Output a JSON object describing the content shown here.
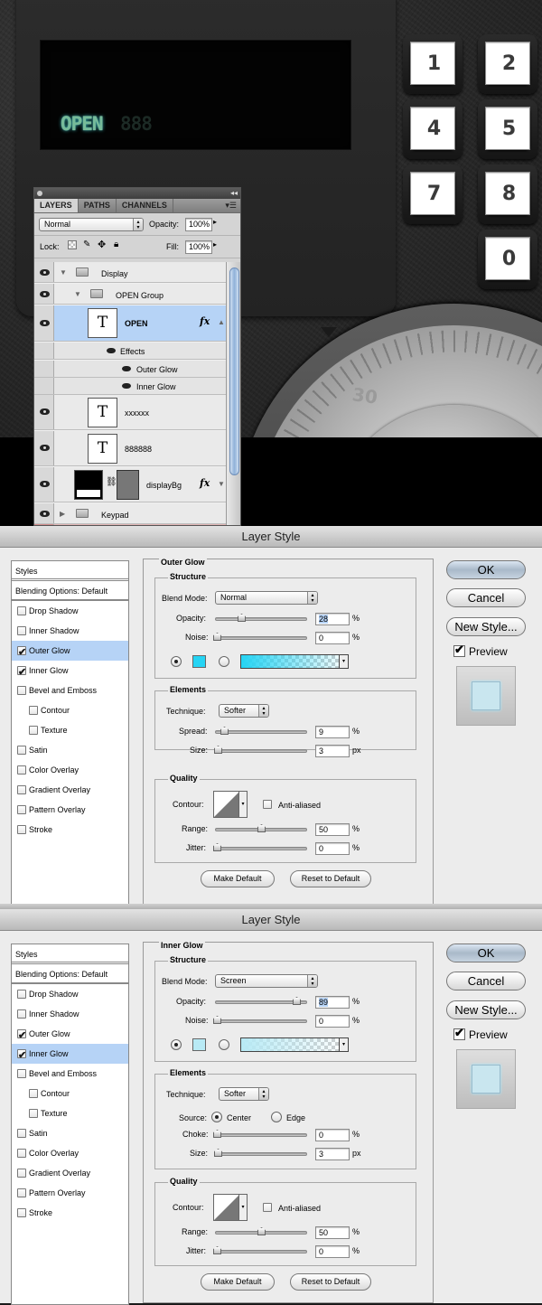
{
  "scene": {
    "display_text": "OPEN",
    "display_ghost": "888",
    "keys": [
      "1",
      "2",
      "4",
      "5",
      "7",
      "8",
      "0"
    ],
    "dial_number": "30"
  },
  "layers_panel": {
    "tabs": [
      "LAYERS",
      "PATHS",
      "CHANNELS"
    ],
    "blend_mode": "Normal",
    "opacity_label": "Opacity:",
    "opacity_value": "100%",
    "lock_label": "Lock:",
    "fill_label": "Fill:",
    "fill_value": "100%",
    "layers": {
      "display": "Display",
      "open_group": "OPEN Group",
      "open": "OPEN",
      "effects": "Effects",
      "outer_glow": "Outer Glow",
      "inner_glow": "Inner Glow",
      "xxxxxx": "xxxxxx",
      "eights": "888888",
      "displaybg": "displayBg",
      "keypad": "Keypad"
    },
    "fx_label": "fx",
    "thumb_letter": "T"
  },
  "dialog1": {
    "title": "Layer Style",
    "styles_header": "Styles",
    "blending": "Blending Options: Default",
    "items": [
      "Drop Shadow",
      "Inner Shadow",
      "Outer Glow",
      "Inner Glow",
      "Bevel and Emboss",
      "Contour",
      "Texture",
      "Satin",
      "Color Overlay",
      "Gradient Overlay",
      "Pattern Overlay",
      "Stroke"
    ],
    "section": "Outer Glow",
    "structure": "Structure",
    "blend_mode_label": "Blend Mode:",
    "blend_mode": "Normal",
    "opacity_label": "Opacity:",
    "opacity": "28",
    "opacity_level": 0.28,
    "noise_label": "Noise:",
    "noise": "0",
    "glow_color": "#25d4f4",
    "elements": "Elements",
    "technique_label": "Technique:",
    "technique": "Softer",
    "spread_label": "Spread:",
    "spread": "9",
    "size_label": "Size:",
    "size": "3",
    "size_unit": "px",
    "quality": "Quality",
    "contour_label": "Contour:",
    "anti_aliased": "Anti-aliased",
    "range_label": "Range:",
    "range": "50",
    "jitter_label": "Jitter:",
    "jitter": "0",
    "make_default": "Make Default",
    "reset_default": "Reset to Default",
    "ok": "OK",
    "cancel": "Cancel",
    "new_style": "New Style...",
    "preview": "Preview",
    "percent": "%"
  },
  "dialog2": {
    "title": "Layer Style",
    "styles_header": "Styles",
    "blending": "Blending Options: Default",
    "items": [
      "Drop Shadow",
      "Inner Shadow",
      "Outer Glow",
      "Inner Glow",
      "Bevel and Emboss",
      "Contour",
      "Texture",
      "Satin",
      "Color Overlay",
      "Gradient Overlay",
      "Pattern Overlay",
      "Stroke"
    ],
    "section": "Inner Glow",
    "structure": "Structure",
    "blend_mode_label": "Blend Mode:",
    "blend_mode": "Screen",
    "opacity_label": "Opacity:",
    "opacity": "89",
    "opacity_level": 0.89,
    "noise_label": "Noise:",
    "noise": "0",
    "glow_color": "#b8eaf5",
    "elements": "Elements",
    "technique_label": "Technique:",
    "technique": "Softer",
    "source_label": "Source:",
    "center": "Center",
    "edge": "Edge",
    "choke_label": "Choke:",
    "choke": "0",
    "size_label": "Size:",
    "size": "3",
    "size_unit": "px",
    "quality": "Quality",
    "contour_label": "Contour:",
    "anti_aliased": "Anti-aliased",
    "range_label": "Range:",
    "range": "50",
    "jitter_label": "Jitter:",
    "jitter": "0",
    "make_default": "Make Default",
    "reset_default": "Reset to Default",
    "ok": "OK",
    "cancel": "Cancel",
    "new_style": "New Style...",
    "preview": "Preview",
    "percent": "%"
  }
}
